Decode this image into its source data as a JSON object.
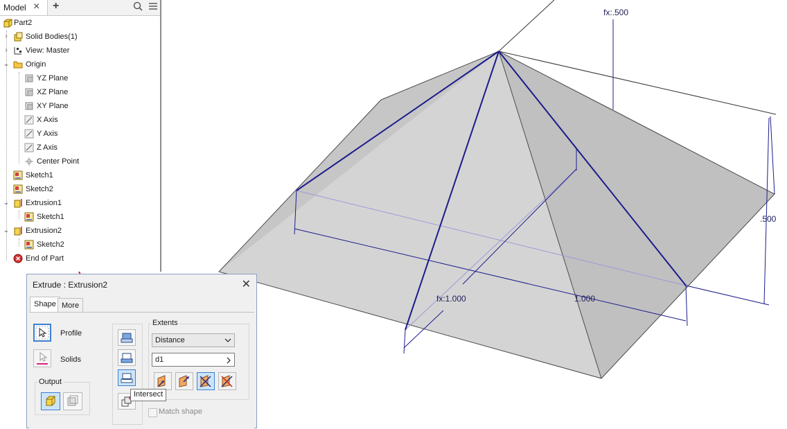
{
  "browser": {
    "tab_label": "Model",
    "tree": [
      {
        "label": "Part2",
        "icon": "part-icon"
      },
      {
        "label": "Solid Bodies(1)",
        "icon": "solid-bodies-icon"
      },
      {
        "label": "View: Master",
        "icon": "view-icon"
      },
      {
        "label": "Origin",
        "icon": "folder-icon"
      },
      {
        "label": "YZ Plane",
        "icon": "plane-icon"
      },
      {
        "label": "XZ Plane",
        "icon": "plane-icon"
      },
      {
        "label": "XY Plane",
        "icon": "plane-icon"
      },
      {
        "label": "X Axis",
        "icon": "axis-icon"
      },
      {
        "label": "Y Axis",
        "icon": "axis-icon"
      },
      {
        "label": "Z Axis",
        "icon": "axis-icon"
      },
      {
        "label": "Center Point",
        "icon": "center-point-icon"
      },
      {
        "label": "Sketch1",
        "icon": "sketch-icon"
      },
      {
        "label": "Sketch2",
        "icon": "sketch-icon"
      },
      {
        "label": "Extrusion1",
        "icon": "extrusion-icon"
      },
      {
        "label": "Sketch1",
        "icon": "sketch-icon"
      },
      {
        "label": "Extrusion2",
        "icon": "extrusion-icon"
      },
      {
        "label": "Sketch2",
        "icon": "sketch-icon"
      },
      {
        "label": "End of Part",
        "icon": "end-of-part-icon"
      }
    ]
  },
  "dialog": {
    "title": "Extrude : Extrusion2",
    "tabs": [
      "Shape",
      "More"
    ],
    "profile_label": "Profile",
    "solids_label": "Solids",
    "output_label": "Output",
    "extents_label": "Extents",
    "extents_value": "Distance",
    "distance_value": "d1",
    "match_shape_label": "Match shape",
    "tooltip": "Intersect"
  },
  "viewport": {
    "dimensions": [
      "fx:.500",
      ".500",
      "fx:1.000",
      "1.000"
    ]
  },
  "colors": {
    "accent": "#3c7fd1",
    "sketch_line": "#1b1b8c",
    "annotation_arrow": "#e02020",
    "body_fill": "#d8d8d8"
  }
}
